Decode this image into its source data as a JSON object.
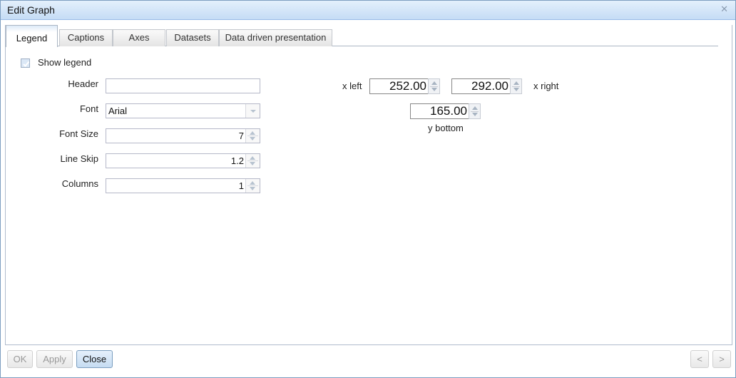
{
  "window": {
    "title": "Edit Graph",
    "close_icon": "close-x-icon"
  },
  "tabs": [
    {
      "label": "Legend",
      "active": true
    },
    {
      "label": "Captions",
      "active": false
    },
    {
      "label": "Axes",
      "active": false
    },
    {
      "label": "Datasets",
      "active": false
    },
    {
      "label": "Data driven presentation",
      "active": false
    }
  ],
  "legend": {
    "show_legend": {
      "label": "Show legend",
      "checked": true
    },
    "header": {
      "label": "Header",
      "value": ""
    },
    "font": {
      "label": "Font",
      "value": "Arial"
    },
    "font_size": {
      "label": "Font Size",
      "value": "7"
    },
    "line_skip": {
      "label": "Line Skip",
      "value": "1.2"
    },
    "columns": {
      "label": "Columns",
      "value": "1"
    }
  },
  "position": {
    "x_left": {
      "label": "x left",
      "value": "252.00"
    },
    "x_right": {
      "label": "x right",
      "value": "292.00"
    },
    "y_bottom": {
      "label": "y bottom",
      "value": "165.00"
    }
  },
  "footer": {
    "ok_label": "OK",
    "apply_label": "Apply",
    "close_label": "Close",
    "prev_label": "<",
    "next_label": ">"
  }
}
